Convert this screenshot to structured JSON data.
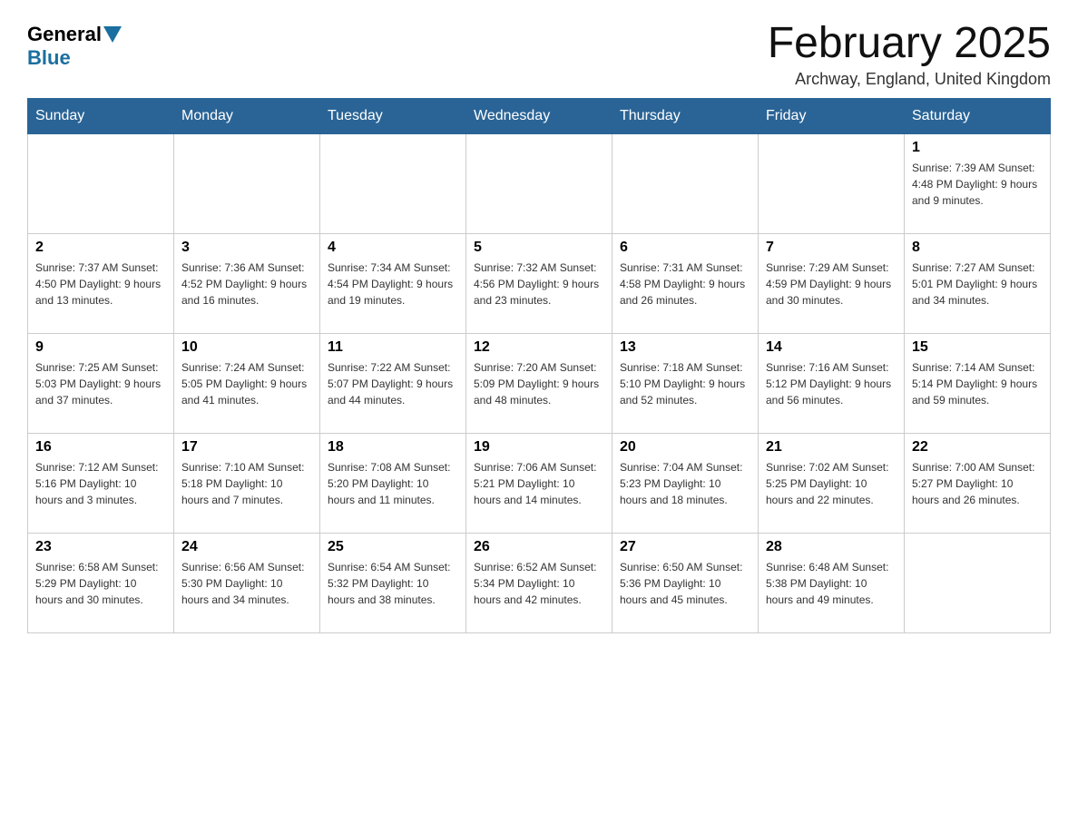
{
  "header": {
    "logo_general": "General",
    "logo_blue": "Blue",
    "title": "February 2025",
    "location": "Archway, England, United Kingdom"
  },
  "weekdays": [
    "Sunday",
    "Monday",
    "Tuesday",
    "Wednesday",
    "Thursday",
    "Friday",
    "Saturday"
  ],
  "weeks": [
    [
      {
        "day": "",
        "info": ""
      },
      {
        "day": "",
        "info": ""
      },
      {
        "day": "",
        "info": ""
      },
      {
        "day": "",
        "info": ""
      },
      {
        "day": "",
        "info": ""
      },
      {
        "day": "",
        "info": ""
      },
      {
        "day": "1",
        "info": "Sunrise: 7:39 AM\nSunset: 4:48 PM\nDaylight: 9 hours and 9 minutes."
      }
    ],
    [
      {
        "day": "2",
        "info": "Sunrise: 7:37 AM\nSunset: 4:50 PM\nDaylight: 9 hours and 13 minutes."
      },
      {
        "day": "3",
        "info": "Sunrise: 7:36 AM\nSunset: 4:52 PM\nDaylight: 9 hours and 16 minutes."
      },
      {
        "day": "4",
        "info": "Sunrise: 7:34 AM\nSunset: 4:54 PM\nDaylight: 9 hours and 19 minutes."
      },
      {
        "day": "5",
        "info": "Sunrise: 7:32 AM\nSunset: 4:56 PM\nDaylight: 9 hours and 23 minutes."
      },
      {
        "day": "6",
        "info": "Sunrise: 7:31 AM\nSunset: 4:58 PM\nDaylight: 9 hours and 26 minutes."
      },
      {
        "day": "7",
        "info": "Sunrise: 7:29 AM\nSunset: 4:59 PM\nDaylight: 9 hours and 30 minutes."
      },
      {
        "day": "8",
        "info": "Sunrise: 7:27 AM\nSunset: 5:01 PM\nDaylight: 9 hours and 34 minutes."
      }
    ],
    [
      {
        "day": "9",
        "info": "Sunrise: 7:25 AM\nSunset: 5:03 PM\nDaylight: 9 hours and 37 minutes."
      },
      {
        "day": "10",
        "info": "Sunrise: 7:24 AM\nSunset: 5:05 PM\nDaylight: 9 hours and 41 minutes."
      },
      {
        "day": "11",
        "info": "Sunrise: 7:22 AM\nSunset: 5:07 PM\nDaylight: 9 hours and 44 minutes."
      },
      {
        "day": "12",
        "info": "Sunrise: 7:20 AM\nSunset: 5:09 PM\nDaylight: 9 hours and 48 minutes."
      },
      {
        "day": "13",
        "info": "Sunrise: 7:18 AM\nSunset: 5:10 PM\nDaylight: 9 hours and 52 minutes."
      },
      {
        "day": "14",
        "info": "Sunrise: 7:16 AM\nSunset: 5:12 PM\nDaylight: 9 hours and 56 minutes."
      },
      {
        "day": "15",
        "info": "Sunrise: 7:14 AM\nSunset: 5:14 PM\nDaylight: 9 hours and 59 minutes."
      }
    ],
    [
      {
        "day": "16",
        "info": "Sunrise: 7:12 AM\nSunset: 5:16 PM\nDaylight: 10 hours and 3 minutes."
      },
      {
        "day": "17",
        "info": "Sunrise: 7:10 AM\nSunset: 5:18 PM\nDaylight: 10 hours and 7 minutes."
      },
      {
        "day": "18",
        "info": "Sunrise: 7:08 AM\nSunset: 5:20 PM\nDaylight: 10 hours and 11 minutes."
      },
      {
        "day": "19",
        "info": "Sunrise: 7:06 AM\nSunset: 5:21 PM\nDaylight: 10 hours and 14 minutes."
      },
      {
        "day": "20",
        "info": "Sunrise: 7:04 AM\nSunset: 5:23 PM\nDaylight: 10 hours and 18 minutes."
      },
      {
        "day": "21",
        "info": "Sunrise: 7:02 AM\nSunset: 5:25 PM\nDaylight: 10 hours and 22 minutes."
      },
      {
        "day": "22",
        "info": "Sunrise: 7:00 AM\nSunset: 5:27 PM\nDaylight: 10 hours and 26 minutes."
      }
    ],
    [
      {
        "day": "23",
        "info": "Sunrise: 6:58 AM\nSunset: 5:29 PM\nDaylight: 10 hours and 30 minutes."
      },
      {
        "day": "24",
        "info": "Sunrise: 6:56 AM\nSunset: 5:30 PM\nDaylight: 10 hours and 34 minutes."
      },
      {
        "day": "25",
        "info": "Sunrise: 6:54 AM\nSunset: 5:32 PM\nDaylight: 10 hours and 38 minutes."
      },
      {
        "day": "26",
        "info": "Sunrise: 6:52 AM\nSunset: 5:34 PM\nDaylight: 10 hours and 42 minutes."
      },
      {
        "day": "27",
        "info": "Sunrise: 6:50 AM\nSunset: 5:36 PM\nDaylight: 10 hours and 45 minutes."
      },
      {
        "day": "28",
        "info": "Sunrise: 6:48 AM\nSunset: 5:38 PM\nDaylight: 10 hours and 49 minutes."
      },
      {
        "day": "",
        "info": ""
      }
    ]
  ]
}
